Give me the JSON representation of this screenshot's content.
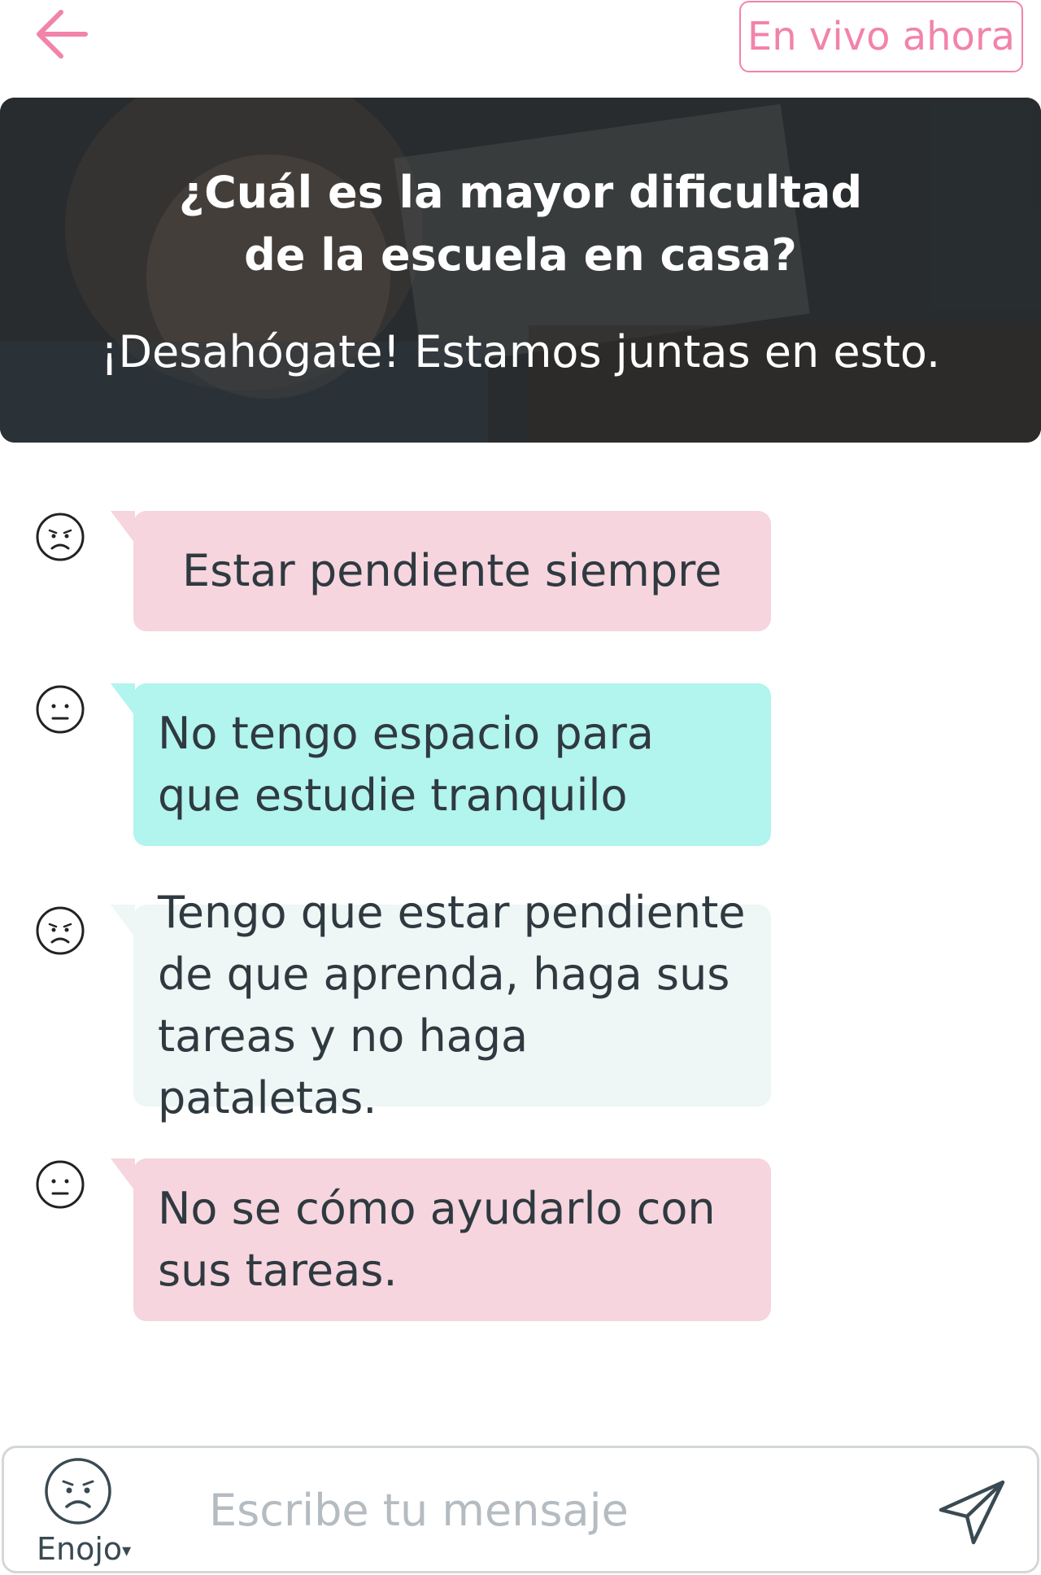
{
  "header": {
    "back_icon": "arrow-left-icon",
    "live_label": "En vivo ahora",
    "accent_color": "#f283ab"
  },
  "banner": {
    "title_line1": "¿Cuál es la mayor dificultad",
    "title_line2": "de la escuela en casa?",
    "subtitle": "¡Desahógate! Estamos juntas en esto."
  },
  "messages": [
    {
      "mood_icon": "angry-face-icon",
      "text": "Estar pendiente siempre",
      "color": "#f6d5de"
    },
    {
      "mood_icon": "neutral-face-icon",
      "text": "No tengo espacio para que estudie tranquilo",
      "color": "#b2f4ee"
    },
    {
      "mood_icon": "angry-face-icon",
      "text": "Tengo que estar pendiente de que aprenda, haga sus tareas y no haga pataletas.",
      "color": "#eef6f6"
    },
    {
      "mood_icon": "neutral-face-icon",
      "text": "No se cómo ayudarlo con sus tareas.",
      "color": "#f6d5de"
    }
  ],
  "composer": {
    "mood_icon": "angry-face-icon",
    "mood_label": "Enojo",
    "mood_caret": "▾",
    "placeholder": "Escribe tu mensaje",
    "send_icon": "send-icon"
  }
}
